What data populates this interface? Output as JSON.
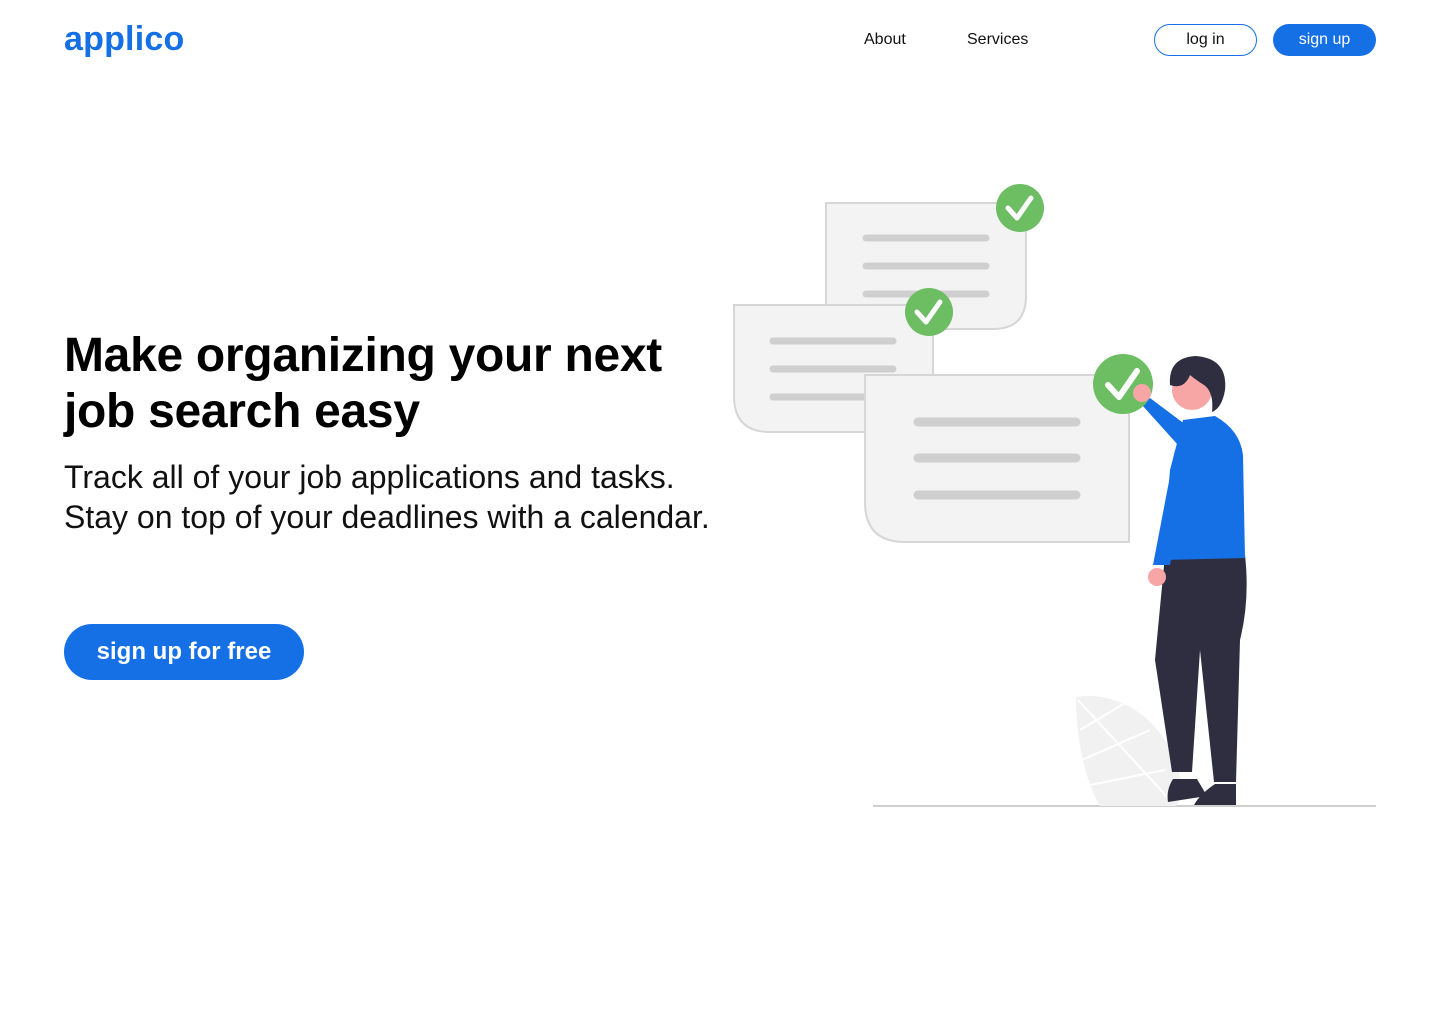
{
  "header": {
    "logo": "applico",
    "nav": {
      "about": "About",
      "services": "Services"
    },
    "login_label": "log in",
    "signup_label": "sign up"
  },
  "hero": {
    "title": "Make organizing your next job search easy",
    "subtitle": "Track all of your job applications and tasks. Stay on top of your deadlines with a calendar.",
    "cta_label": "sign up for free"
  },
  "colors": {
    "brand": "#1570e6",
    "check": "#6dbd63",
    "card_border": "#d6d6d6",
    "card_line": "#cfcfcf",
    "pants": "#2f2e41",
    "skin": "#f8a5a5"
  },
  "icons": [
    "check-icon",
    "document-card",
    "person-illustration",
    "plant-illustration"
  ]
}
